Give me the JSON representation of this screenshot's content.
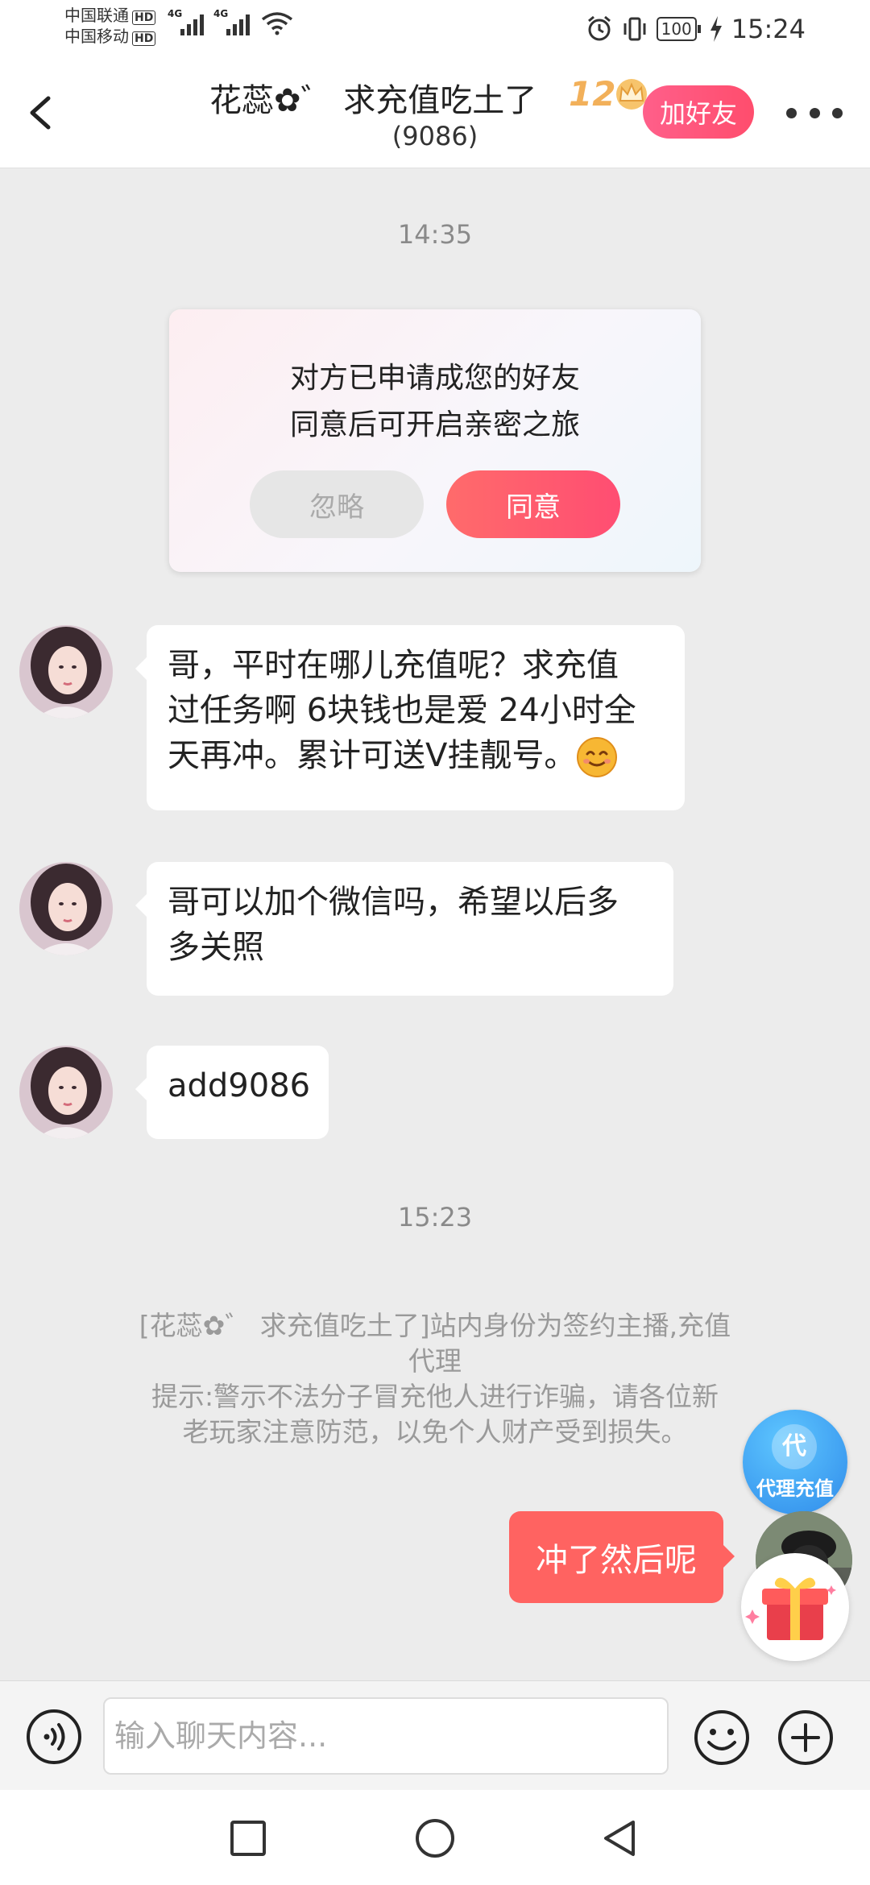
{
  "status_bar": {
    "carrier1": "中国联通",
    "carrier2": "中国移动",
    "hd": "HD",
    "net1": "4G",
    "net2": "4G",
    "battery": "100",
    "time": "15:24"
  },
  "header": {
    "title": "花蕊✿゛ 求充值吃土了",
    "level": "12",
    "subtitle": "(9086)",
    "add_friend": "加好友"
  },
  "chat": {
    "time1": "14:35",
    "friend_card": {
      "line1": "对方已申请成您的好友",
      "line2": "同意后可开启亲密之旅",
      "ignore": "忽略",
      "agree": "同意"
    },
    "messages": [
      {
        "l1": "哥，平时在哪儿充值呢？求充值",
        "l2": "过任务啊 6块钱也是爱 24小时全",
        "l3": "天再冲。累计可送V挂靓号。"
      },
      {
        "l1": "哥可以加个微信吗，希望以后多",
        "l2": "多关照"
      },
      {
        "l1": "add9086"
      }
    ],
    "time2": "15:23",
    "notice": {
      "l1": "[花蕊✿゛ 求充值吃土了]站内身份为签约主播,充值",
      "l2": "代理",
      "l3": "提示:警示不法分子冒充他人进行诈骗，请各位新",
      "l4": "老玩家注意防范，以免个人财产受到损失。"
    },
    "agent_fab": {
      "char": "代",
      "label": "代理充值"
    },
    "my_message": "冲了然后呢"
  },
  "input": {
    "placeholder": "输入聊天内容..."
  },
  "colors": {
    "accent": "#ff4d6d",
    "my_bubble": "#ff6361",
    "agent_blue": "#2f8bea"
  }
}
